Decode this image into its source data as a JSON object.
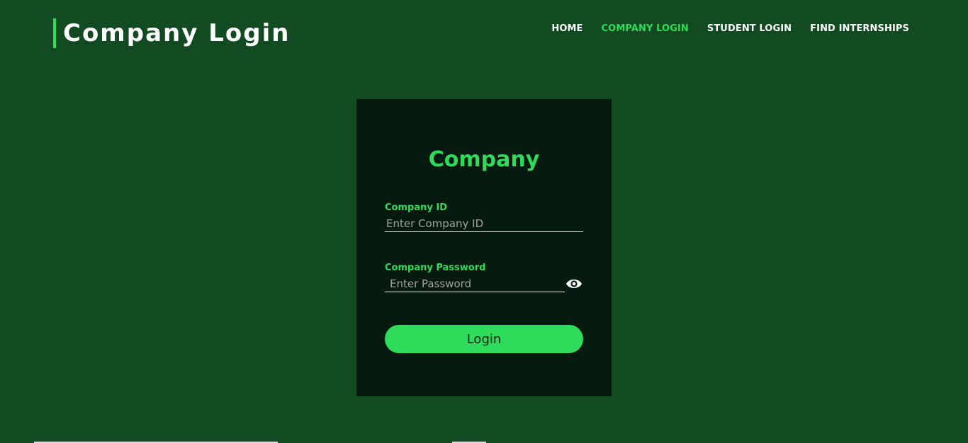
{
  "header": {
    "title": "Company Login"
  },
  "nav": {
    "items": [
      {
        "label": "HOME",
        "active": false
      },
      {
        "label": "COMPANY LOGIN",
        "active": true
      },
      {
        "label": "STUDENT LOGIN",
        "active": false
      },
      {
        "label": "FIND INTERNSHIPS",
        "active": false
      }
    ]
  },
  "login_card": {
    "title": "Company",
    "company_id": {
      "label": "Company ID",
      "placeholder": "Enter Company ID",
      "value": ""
    },
    "password": {
      "label": "Company Password",
      "placeholder": "Enter Password",
      "value": "",
      "toggle_icon": "eye-icon"
    },
    "submit_label": "Login"
  },
  "colors": {
    "page_background": "#124a22",
    "card_background": "#071a0f",
    "accent": "#2edb5a",
    "text_light": "#ffffff"
  }
}
